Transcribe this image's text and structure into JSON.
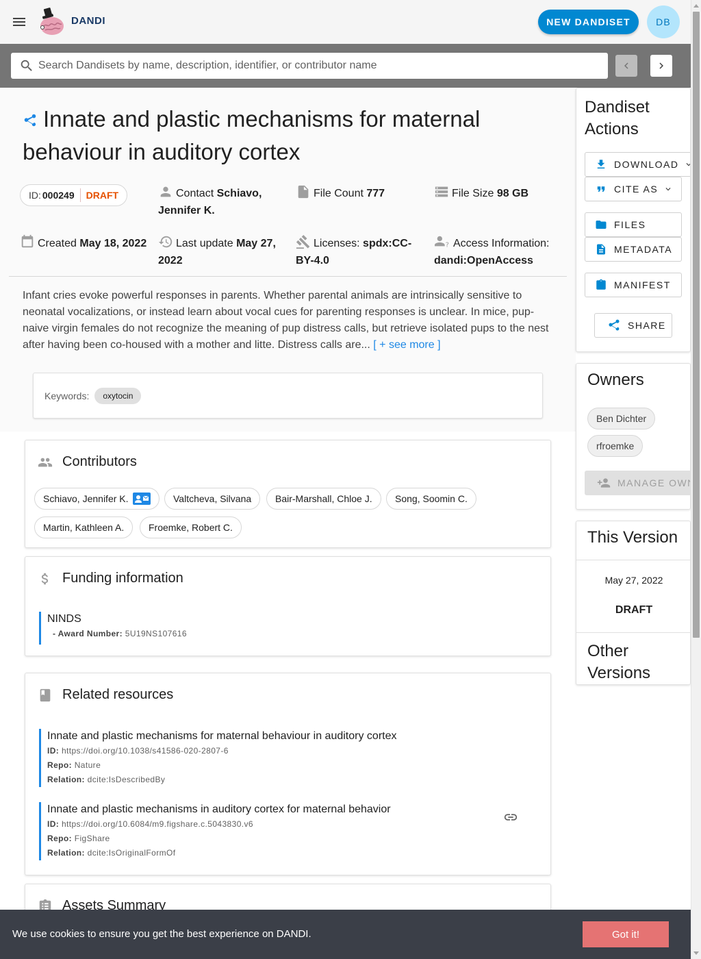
{
  "colors": {
    "accent": "#0288d1",
    "draft": "#e65100",
    "resource_border": "#1e88e5",
    "cookie_button": "#e57373",
    "search_bar": "#757575"
  },
  "app": {
    "brand": "DANDI",
    "new_button": "NEW DANDISET",
    "avatar_initials": "DB",
    "menu_icon": "menu-icon",
    "logo_icon": "brain-logo-icon"
  },
  "search": {
    "placeholder": "Search Dandisets by name, description, identifier, or contributor name",
    "value": ""
  },
  "dandiset": {
    "title": "Innate and plastic mechanisms for maternal behaviour in auditory cortex",
    "id_label": "ID:",
    "id": "000249",
    "status": "DRAFT",
    "contact_label": "Contact",
    "contact": "Schiavo, Jennifer K.",
    "file_count_label": "File Count",
    "file_count": "777",
    "file_size_label": "File Size",
    "file_size": "98 GB",
    "created_label": "Created",
    "created": "May 18, 2022",
    "updated_label": "Last update",
    "updated": "May 27, 2022",
    "licenses_label": "Licenses:",
    "license": "spdx:CC-BY-4.0",
    "access_label": "Access Information:",
    "access": "dandi:OpenAccess",
    "description": "Infant cries evoke powerful responses in parents. Whether parental animals are intrinsically sensitive to neonatal vocalizations, or instead learn about vocal cues for parenting responses is unclear. In mice, pup-naive virgin females do not recognize the meaning of pup distress calls, but retrieve isolated pups to the nest after having been co-housed with a mother and litte. Distress calls are...",
    "see_more": "[ + see more ]",
    "keywords_label": "Keywords:",
    "keywords": [
      "oxytocin"
    ]
  },
  "contributors": {
    "title": "Contributors",
    "people": [
      "Schiavo, Jennifer K.",
      "Valtcheva, Silvana",
      "Bair-Marshall, Chloe J.",
      "Song, Soomin C.",
      "Martin, Kathleen A.",
      "Froemke, Robert C."
    ]
  },
  "funding": {
    "title": "Funding information",
    "items": [
      {
        "name": "NINDS",
        "award_label": "- Award Number:",
        "award": "5U19NS107616"
      }
    ]
  },
  "resources": {
    "title": "Related resources",
    "id_label": "ID:",
    "repo_label": "Repo:",
    "relation_label": "Relation:",
    "items": [
      {
        "title": "Innate and plastic mechanisms for maternal behaviour in auditory cortex",
        "id": "https://doi.org/10.1038/s41586-020-2807-6",
        "repo": "Nature",
        "relation": "dcite:IsDescribedBy"
      },
      {
        "title": "Innate and plastic mechanisms in auditory cortex for maternal behavior",
        "id": "https://doi.org/10.6084/m9.figshare.c.5043830.v6",
        "repo": "FigShare",
        "relation": "dcite:IsOriginalFormOf"
      }
    ]
  },
  "assets_summary": {
    "title": "Assets Summary"
  },
  "actions": {
    "title_line1": "Dandiset",
    "title_line2": "Actions",
    "download": "DOWNLOAD",
    "cite": "CITE AS",
    "files": "FILES",
    "metadata": "METADATA",
    "manifest": "MANIFEST",
    "share": "SHARE"
  },
  "owners": {
    "title": "Owners",
    "list": [
      "Ben Dichter",
      "rfroemke"
    ],
    "manage": "MANAGE OWNERS"
  },
  "version": {
    "title": "This Version",
    "date": "May 27, 2022",
    "name": "DRAFT"
  },
  "other_versions": {
    "title_line1": "Other",
    "title_line2": "Versions"
  },
  "cookie": {
    "text": "We use cookies to ensure you get the best experience on DANDI.",
    "button": "Got it!"
  }
}
